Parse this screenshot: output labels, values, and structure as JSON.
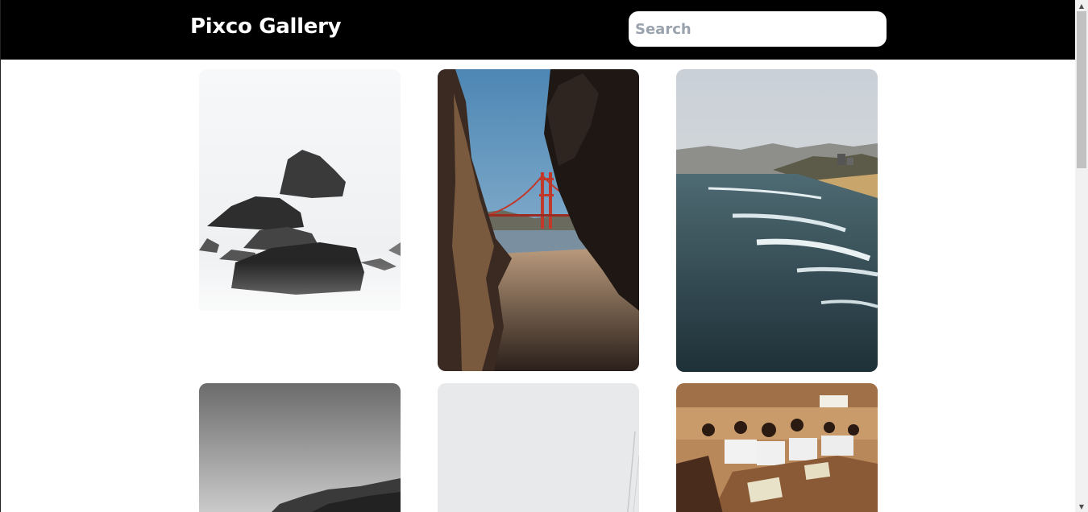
{
  "header": {
    "brand": "Pixco Gallery",
    "search_placeholder": "Search",
    "search_value": ""
  },
  "colors": {
    "header_bg": "#000000",
    "brand_text": "#ffffff",
    "page_bg": "#ffffff"
  },
  "gallery": {
    "photos": [
      "misty-rocks-black-and-white",
      "golden-gate-bridge-through-rocks",
      "ocean-waves-coastline",
      "black-and-white-mountains",
      "pale-grey-sky",
      "classroom-students"
    ]
  },
  "scrollbar": {
    "up_icon": "arrow-up-icon",
    "down_icon": "arrow-down-icon"
  }
}
